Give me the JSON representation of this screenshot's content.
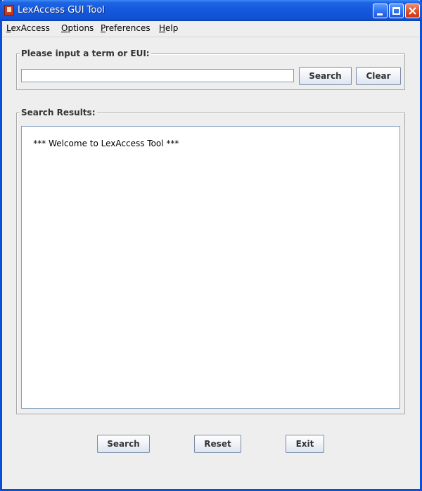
{
  "window": {
    "title": "LexAccess GUI Tool",
    "accent_color": "#1458dc",
    "close_color": "#dc4a22"
  },
  "menu": {
    "items": [
      {
        "mnemonic": "L",
        "rest": "exAccess"
      },
      {
        "mnemonic": "O",
        "rest": "ptions"
      },
      {
        "mnemonic": "P",
        "rest": "references"
      },
      {
        "mnemonic": "H",
        "rest": "elp"
      }
    ]
  },
  "input_panel": {
    "legend": "Please input a term or EUI:",
    "term_value": "",
    "search_label": "Search",
    "clear_label": "Clear"
  },
  "results_panel": {
    "legend": "Search Results:",
    "text": "*** Welcome to LexAccess Tool ***"
  },
  "footer": {
    "search_label": "Search",
    "reset_label": "Reset",
    "exit_label": "Exit"
  }
}
